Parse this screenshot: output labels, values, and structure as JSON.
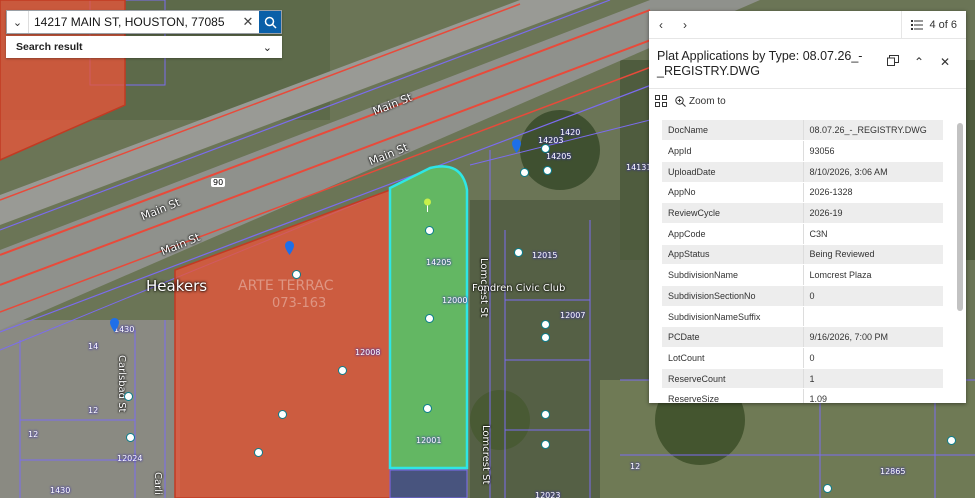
{
  "search": {
    "value": "14217 MAIN ST, HOUSTON, 77085",
    "result_label": "Search result"
  },
  "map": {
    "road_labels": [
      "Main St",
      "Main St",
      "Main St",
      "Main St"
    ],
    "highway_shield": "90",
    "cross_streets": [
      "Carlsbad St",
      "Lomcrest St",
      "Lomcrest St",
      "Carli"
    ],
    "place_label": "Heakers",
    "civic_label": "Fondren Civic Club",
    "faded_labels": [
      "ARTE TERRAC",
      "073-163"
    ],
    "parcel_numbers": [
      "14203",
      "14205",
      "1420",
      "14131",
      "12015",
      "12007",
      "12000",
      "12001",
      "12024",
      "12008",
      "1430",
      "14",
      "12",
      "12023",
      "12865",
      "12",
      "12",
      "1430",
      "14205"
    ],
    "colors": {
      "red_parcel": "#e8543a",
      "green_parcel": "#5fd36a",
      "cyan_outline": "#2ee6e6",
      "parcel_lines": "#7b6cf0"
    }
  },
  "popup": {
    "page_label": "4 of 6",
    "title": "Plat Applications by Type: 08.07.26_-_REGISTRY.DWG",
    "zoom_label": "Zoom to",
    "rows": [
      {
        "k": "DocName",
        "v": "08.07.26_-_REGISTRY.DWG"
      },
      {
        "k": "AppId",
        "v": "93056"
      },
      {
        "k": "UploadDate",
        "v": "8/10/2026, 3:06 AM"
      },
      {
        "k": "AppNo",
        "v": "2026-1328"
      },
      {
        "k": "ReviewCycle",
        "v": "2026-19"
      },
      {
        "k": "AppCode",
        "v": "C3N"
      },
      {
        "k": "AppStatus",
        "v": "Being Reviewed"
      },
      {
        "k": "SubdivisionName",
        "v": "Lomcrest Plaza"
      },
      {
        "k": "SubdivisionSectionNo",
        "v": "0"
      },
      {
        "k": "SubdivisionNameSuffix",
        "v": ""
      },
      {
        "k": "PCDate",
        "v": "9/16/2026, 7:00 PM"
      },
      {
        "k": "LotCount",
        "v": "0"
      },
      {
        "k": "ReserveCount",
        "v": "1"
      },
      {
        "k": "ReserveSize",
        "v": "1.09"
      }
    ]
  }
}
